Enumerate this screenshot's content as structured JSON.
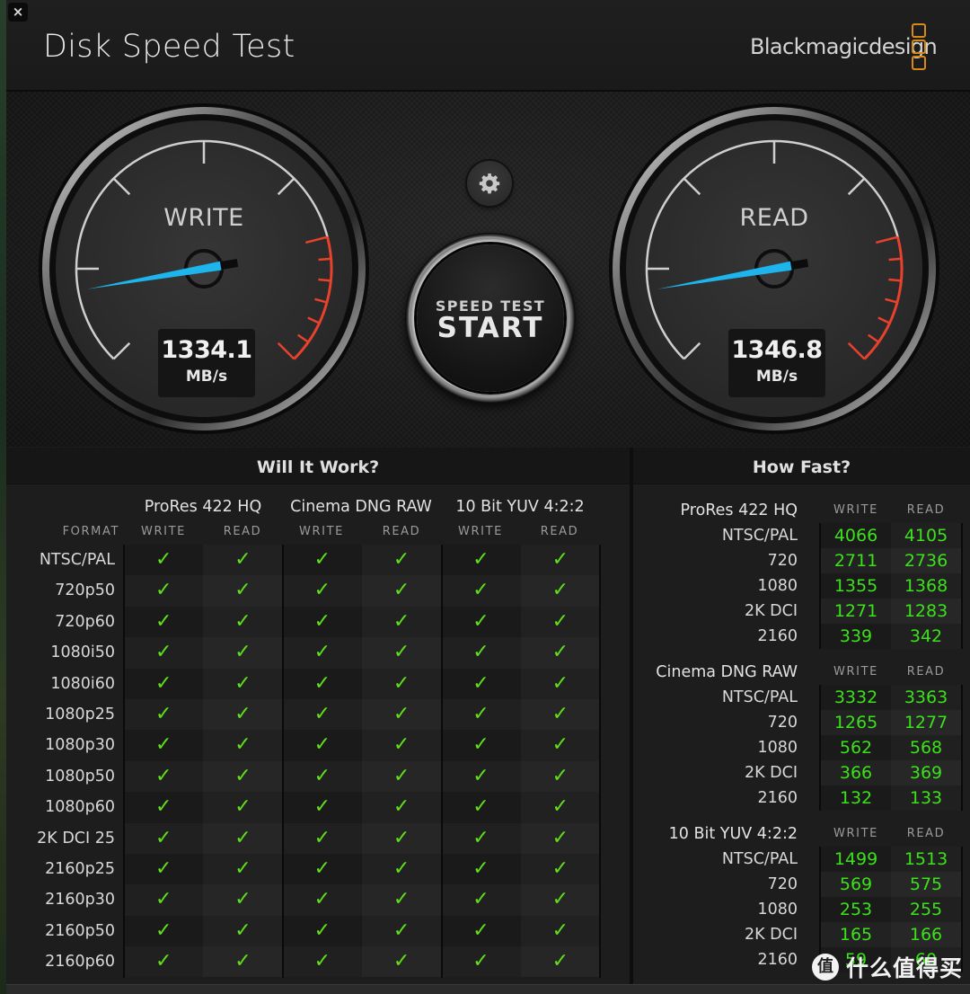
{
  "window": {
    "title": "Disk Speed Test",
    "brand": "Blackmagicdesign",
    "close_label": "×"
  },
  "colors": {
    "needle": "#1eb4ec",
    "redline": "#e8412c",
    "check": "#5fe01a",
    "value_green": "#3be21a",
    "brand_orange": "#d88a18"
  },
  "gauges": {
    "write": {
      "label": "WRITE",
      "value": "1334.1",
      "unit": "MB/s",
      "needle_fraction": 0.13
    },
    "read": {
      "label": "READ",
      "value": "1346.8",
      "unit": "MB/s",
      "needle_fraction": 0.13
    }
  },
  "controls": {
    "settings_icon": "gear-icon",
    "start_sub": "SPEED TEST",
    "start_main": "START"
  },
  "will_it_work": {
    "title": "Will It Work?",
    "format_header": "FORMAT",
    "codecs": [
      {
        "name": "ProRes 422 HQ",
        "write": "WRITE",
        "read": "READ"
      },
      {
        "name": "Cinema DNG RAW",
        "write": "WRITE",
        "read": "READ"
      },
      {
        "name": "10 Bit YUV 4:2:2",
        "write": "WRITE",
        "read": "READ"
      }
    ],
    "check_glyph": "✓",
    "rows": [
      {
        "format": "NTSC/PAL",
        "results": [
          true,
          true,
          true,
          true,
          true,
          true
        ]
      },
      {
        "format": "720p50",
        "results": [
          true,
          true,
          true,
          true,
          true,
          true
        ]
      },
      {
        "format": "720p60",
        "results": [
          true,
          true,
          true,
          true,
          true,
          true
        ]
      },
      {
        "format": "1080i50",
        "results": [
          true,
          true,
          true,
          true,
          true,
          true
        ]
      },
      {
        "format": "1080i60",
        "results": [
          true,
          true,
          true,
          true,
          true,
          true
        ]
      },
      {
        "format": "1080p25",
        "results": [
          true,
          true,
          true,
          true,
          true,
          true
        ]
      },
      {
        "format": "1080p30",
        "results": [
          true,
          true,
          true,
          true,
          true,
          true
        ]
      },
      {
        "format": "1080p50",
        "results": [
          true,
          true,
          true,
          true,
          true,
          true
        ]
      },
      {
        "format": "1080p60",
        "results": [
          true,
          true,
          true,
          true,
          true,
          true
        ]
      },
      {
        "format": "2K DCI 25",
        "results": [
          true,
          true,
          true,
          true,
          true,
          true
        ]
      },
      {
        "format": "2160p25",
        "results": [
          true,
          true,
          true,
          true,
          true,
          true
        ]
      },
      {
        "format": "2160p30",
        "results": [
          true,
          true,
          true,
          true,
          true,
          true
        ]
      },
      {
        "format": "2160p50",
        "results": [
          true,
          true,
          true,
          true,
          true,
          true
        ]
      },
      {
        "format": "2160p60",
        "results": [
          true,
          true,
          true,
          true,
          true,
          true
        ]
      }
    ]
  },
  "how_fast": {
    "title": "How Fast?",
    "write_header": "WRITE",
    "read_header": "READ",
    "groups": [
      {
        "codec": "ProRes 422 HQ",
        "rows": [
          {
            "format": "NTSC/PAL",
            "write": "4066",
            "read": "4105"
          },
          {
            "format": "720",
            "write": "2711",
            "read": "2736"
          },
          {
            "format": "1080",
            "write": "1355",
            "read": "1368"
          },
          {
            "format": "2K DCI",
            "write": "1271",
            "read": "1283"
          },
          {
            "format": "2160",
            "write": "339",
            "read": "342"
          }
        ]
      },
      {
        "codec": "Cinema DNG RAW",
        "rows": [
          {
            "format": "NTSC/PAL",
            "write": "3332",
            "read": "3363"
          },
          {
            "format": "720",
            "write": "1265",
            "read": "1277"
          },
          {
            "format": "1080",
            "write": "562",
            "read": "568"
          },
          {
            "format": "2K DCI",
            "write": "366",
            "read": "369"
          },
          {
            "format": "2160",
            "write": "132",
            "read": "133"
          }
        ]
      },
      {
        "codec": "10 Bit YUV 4:2:2",
        "rows": [
          {
            "format": "NTSC/PAL",
            "write": "1499",
            "read": "1513"
          },
          {
            "format": "720",
            "write": "569",
            "read": "575"
          },
          {
            "format": "1080",
            "write": "253",
            "read": "255"
          },
          {
            "format": "2K DCI",
            "write": "165",
            "read": "166"
          },
          {
            "format": "2160",
            "write": "59",
            "read": "60"
          }
        ]
      }
    ]
  },
  "watermark": {
    "glyph": "值",
    "text": "什么值得买"
  }
}
